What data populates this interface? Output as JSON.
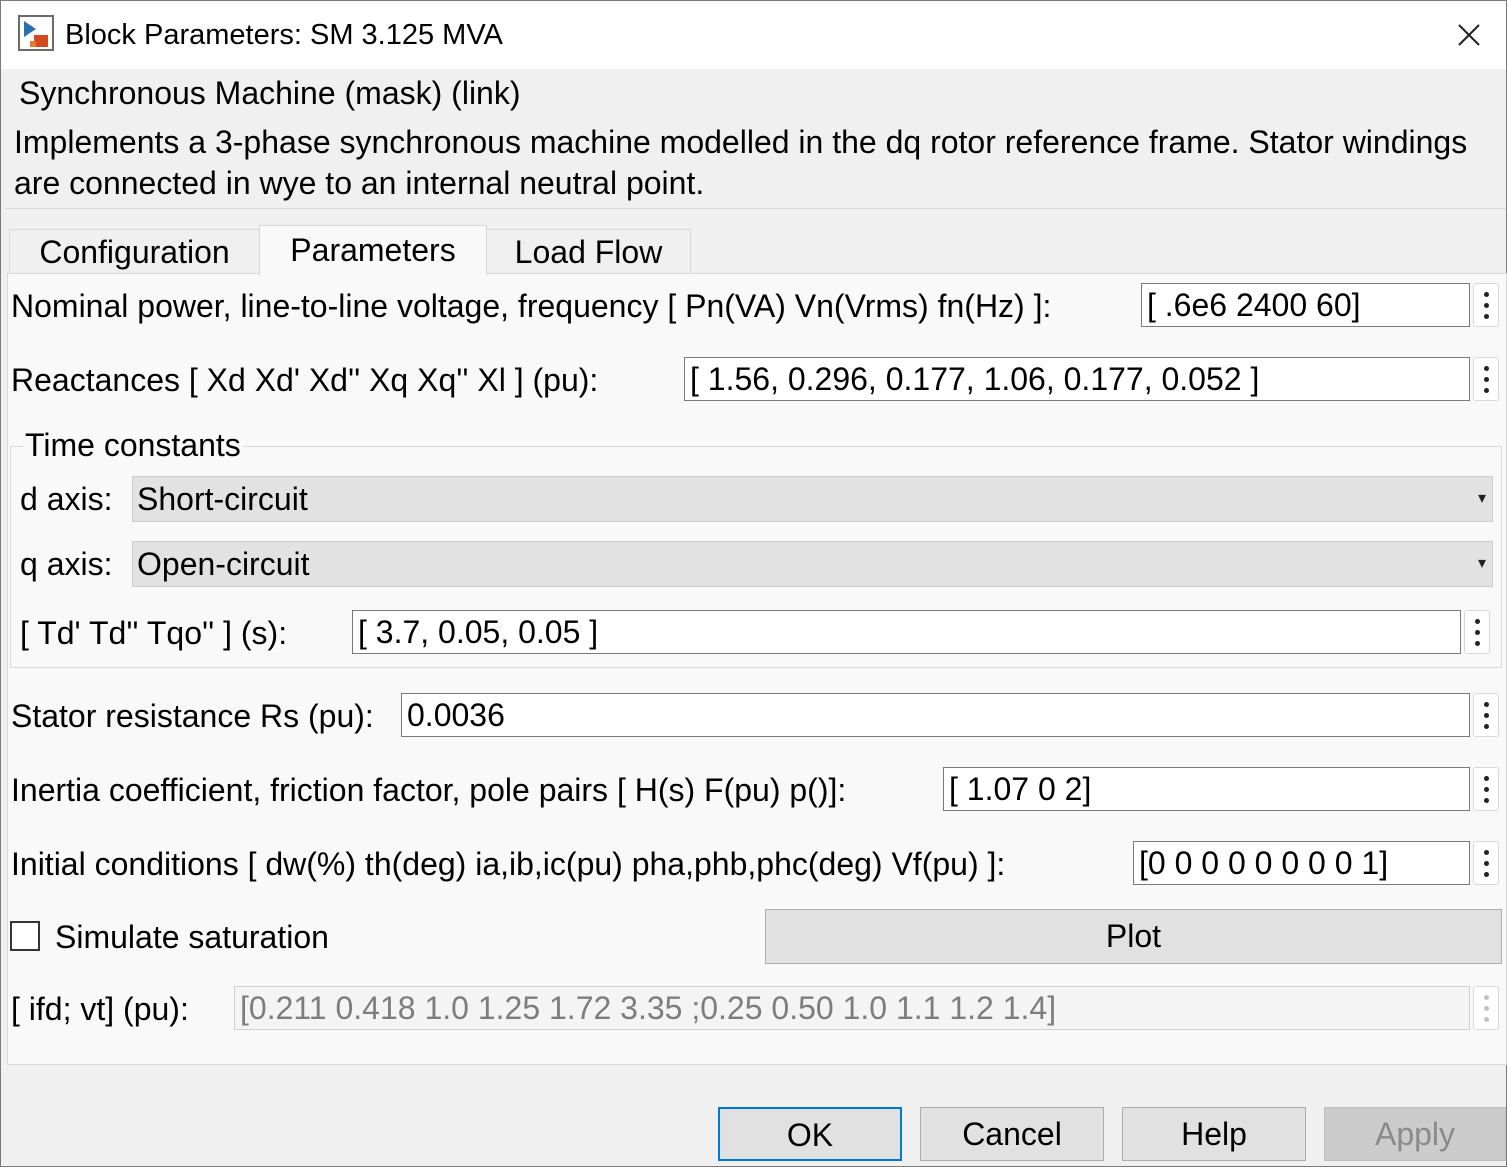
{
  "window": {
    "title": "Block Parameters: SM 3.125 MVA"
  },
  "mask": {
    "title": "Synchronous Machine (mask) (link)",
    "description": "Implements a 3-phase synchronous machine modelled in the dq rotor reference frame. Stator windings are connected in wye to an internal neutral point."
  },
  "tabs": [
    {
      "label": "Configuration",
      "active": false
    },
    {
      "label": "Parameters",
      "active": true
    },
    {
      "label": "Load Flow",
      "active": false
    }
  ],
  "params": {
    "nominal": {
      "label": "Nominal power, line-to-line voltage, frequency [ Pn(VA)  Vn(Vrms)  fn(Hz) ]:",
      "value": "[ .6e6  2400  60]"
    },
    "reactances": {
      "label": "Reactances [ Xd  Xd'  Xd''  Xq  Xq''  Xl ] (pu):",
      "value": "[ 1.56, 0.296, 0.177, 1.06, 0.177, 0.052 ]"
    },
    "time_constants": {
      "group_title": "Time constants",
      "d_axis": {
        "label": "d axis:",
        "value": "Short-circuit"
      },
      "q_axis": {
        "label": "q axis:",
        "value": "Open-circuit"
      },
      "tvals": {
        "label": "[ Td'  Td''  Tqo'' ] (s):",
        "value": "[ 3.7, 0.05, 0.05 ]"
      }
    },
    "stator": {
      "label": "Stator resistance Rs (pu):",
      "value": "0.0036"
    },
    "inertia": {
      "label": "Inertia coefficient, friction factor, pole pairs [ H(s)  F(pu)  p()]:",
      "value": "[ 1.07  0 2]"
    },
    "initial": {
      "label": "Initial conditions [ dw(%)  th(deg)  ia,ib,ic(pu)  pha,phb,phc(deg)  Vf(pu) ]:",
      "value": "[0 0 0 0 0 0 0 0 1]"
    },
    "saturation": {
      "label": "Simulate saturation",
      "checked": false,
      "plot_label": "Plot"
    },
    "ifd_vt": {
      "label": "[ ifd; vt] (pu):",
      "value": "[0.211 0.418 1.0 1.25 1.72 3.35 ;0.25 0.50 1.0 1.1 1.2 1.4]"
    }
  },
  "buttons": {
    "ok": "OK",
    "cancel": "Cancel",
    "help": "Help",
    "apply": "Apply"
  },
  "icons": {
    "app": "simulink-block-icon",
    "close": "close-icon",
    "kebab": "more-options-icon"
  }
}
